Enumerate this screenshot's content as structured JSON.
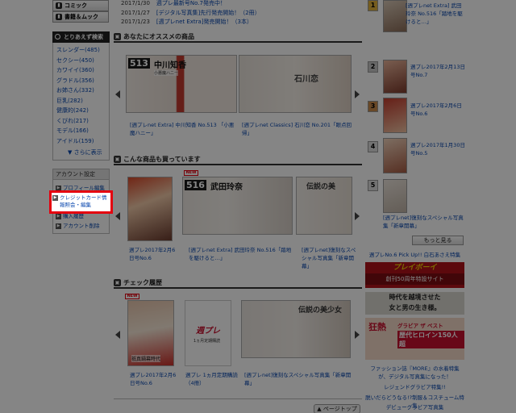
{
  "sidebar": {
    "comics_label": "コミック",
    "books_label": "書籍＆ムック",
    "search_title": "とりあえず検索",
    "tags": [
      {
        "label": "スレンダー(485)"
      },
      {
        "label": "セクシー(450)"
      },
      {
        "label": "カワイイ(360)"
      },
      {
        "label": "グラドル(356)"
      },
      {
        "label": "お姉さん(332)"
      },
      {
        "label": "巨乳(282)"
      },
      {
        "label": "健康的(242)"
      },
      {
        "label": "くびれ(217)"
      },
      {
        "label": "モデル(166)"
      },
      {
        "label": "アイドル(159)"
      }
    ],
    "more": "さらに表示",
    "account_title": "アカウント設定",
    "account_items": {
      "profile": "プロフィール編集",
      "credit_1": "クレジットカード情",
      "credit_2": "報照会・編集",
      "history": "購入履歴",
      "delete": "アカウント削除"
    }
  },
  "news": [
    {
      "date": "2017/1/30",
      "text": "週プレ最新号No.7発売中！"
    },
    {
      "date": "2017/1/27",
      "text": "[デジタル写真集]先行発売開始！（2冊）"
    },
    {
      "date": "2017/1/23",
      "text": "[週プレnet Extra]発売開始！（3本）"
    }
  ],
  "recommend": {
    "title": "あなたにオススメの商品",
    "items": [
      {
        "num": "513",
        "name": "中川知香",
        "sub": "小悪魔ハニー",
        "caption": "[週プレnet Extra] 中川知香 No.513 「小悪魔ハニー」"
      },
      {
        "num": "",
        "name": "石川恋",
        "sub": "",
        "caption": "[週プレnet Classics] 石川恋 No.201「眼点回帰」"
      }
    ]
  },
  "also_bought": {
    "title": "こんな商品も買っています",
    "new_label": "NEW",
    "items": [
      {
        "caption": "週プレ2017年2月6日号No.6"
      },
      {
        "num": "516",
        "name": "武田玲奈",
        "caption": "[週プレnet Extra] 武田玲奈 No.516「踏地を駆けると…」"
      },
      {
        "name": "伝説の美",
        "caption": "[週プレnet]復刻なスペシャル写真集「新章開幕」"
      }
    ]
  },
  "history": {
    "title": "チェック履歴",
    "new_label": "NEW",
    "items": [
      {
        "cover_text": "祇真鍋幕時代",
        "caption": "週プレ2017年2月6日号No.6"
      },
      {
        "logo": "週プレ",
        "sub": "1ヵ月定期購読",
        "caption": "週プレ 1ヵ月定期購読（4冊）"
      },
      {
        "name": "伝説の美少女",
        "caption": "[週プレnet]復刻なスペシャル写真集「新章開幕」"
      }
    ]
  },
  "ranking": {
    "items": [
      {
        "rank": "1",
        "text": "[週プレnet Extra] 武田玲奈 No.516「踏地を駆けると…」"
      },
      {
        "rank": "2",
        "text": "週プレ2017年2月13日号No.7"
      },
      {
        "rank": "3",
        "text": "週プレ2017年2月6日号No.6"
      },
      {
        "rank": "4",
        "text": "週プレ2017年1月30日号No.5"
      },
      {
        "rank": "5",
        "text": "[週プレnet]復刻なスペシャル写真集「新章開幕」"
      }
    ],
    "more": "もっと見る"
  },
  "right_links": {
    "pickup": "週プレNo.6 Pick Up!! 白石あさえ特集",
    "ad1_title": "プレイボーイ",
    "ad1_sub": "創刊50周年特設サイト",
    "ad2_l1": "時代を越境させた",
    "ad2_l2": "女と男の生き様。",
    "ad3_l1": "狂熱",
    "ad3_l2": "グラビア ザ ベスト",
    "ad3_l3": "歴代ヒロイン150人超",
    "bottom1": "ファッション誌『MORE』の水着特集が、デジタル写真集になった！",
    "bottom2": "レジェンドグラビア特集!!",
    "bottom3": "脱いだらどうなる!?制服＆コスチューム特集",
    "bottom4": "デビューグラビア写真集"
  },
  "page_top": "ページトップ",
  "highlight_color": "#e4000f"
}
